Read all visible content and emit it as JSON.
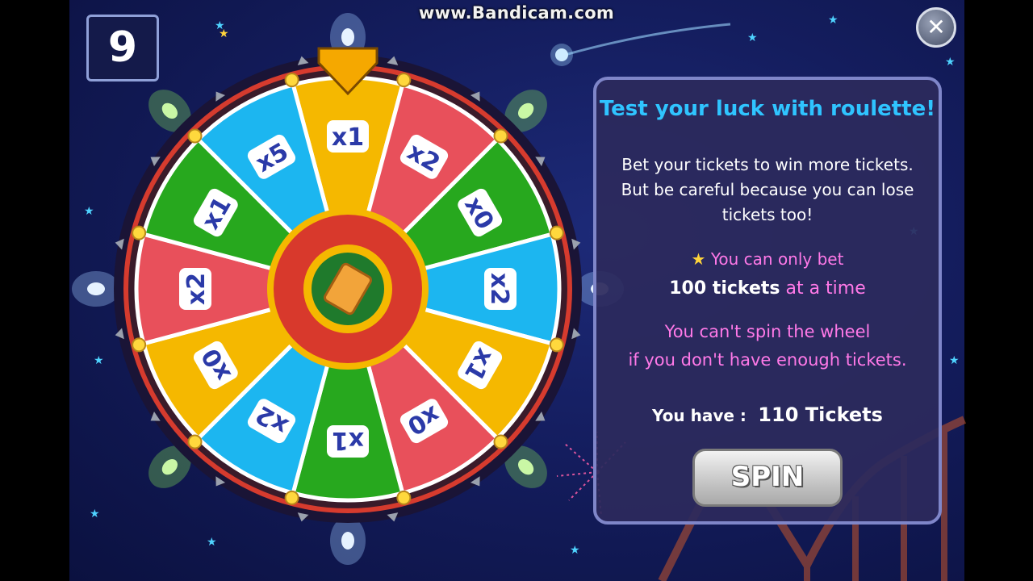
{
  "watermark": "www.Bandicam.com",
  "level": "9",
  "close_label": "✕",
  "panel": {
    "title": "Test your luck with roulette!",
    "desc_line1": "Bet your tickets to win more tickets.",
    "desc_line2": "But be careful because you can lose",
    "desc_line3": "tickets too!",
    "bet_line1": "You can only bet",
    "bet_amount": "100 tickets",
    "bet_suffix": "at a time",
    "warn_line1": "You can't spin the wheel",
    "warn_line2": "if you don't have enough tickets.",
    "you_have_label": "You have :",
    "tickets_value": "110 Tickets",
    "spin_label": "SPIN"
  },
  "wheel": {
    "segments": [
      {
        "label": "x1",
        "color": "#f5b800"
      },
      {
        "label": "x2",
        "color": "#e8505b"
      },
      {
        "label": "x0",
        "color": "#27a81e"
      },
      {
        "label": "x2",
        "color": "#1cb6f0"
      },
      {
        "label": "x1",
        "color": "#f5b800"
      },
      {
        "label": "x0",
        "color": "#e8505b"
      },
      {
        "label": "x1",
        "color": "#27a81e"
      },
      {
        "label": "x2",
        "color": "#1cb6f0"
      },
      {
        "label": "x0",
        "color": "#f5b800"
      },
      {
        "label": "x2",
        "color": "#e8505b"
      },
      {
        "label": "x1",
        "color": "#27a81e"
      },
      {
        "label": "x5",
        "color": "#1cb6f0"
      }
    ],
    "pointer_color": "#f5a800",
    "rim_color": "#d63b2e",
    "hub_icon": "ticket-icon"
  }
}
